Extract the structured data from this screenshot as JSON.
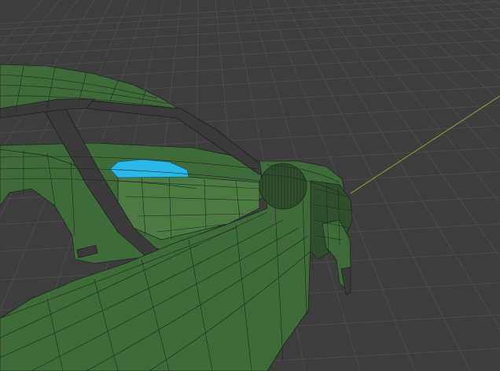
{
  "viewport": {
    "background_color": "#3d3d3d",
    "grid_color": "#4a4a4a",
    "axis_color": "#7d9a3a",
    "mesh_fill_color": "#3f6b3a",
    "mesh_dark_color": "#2f4f2c",
    "mesh_wire_color": "#1e2a1e",
    "selected_face_color": "#29b8e8",
    "frame_color": "#3a3a3a"
  }
}
